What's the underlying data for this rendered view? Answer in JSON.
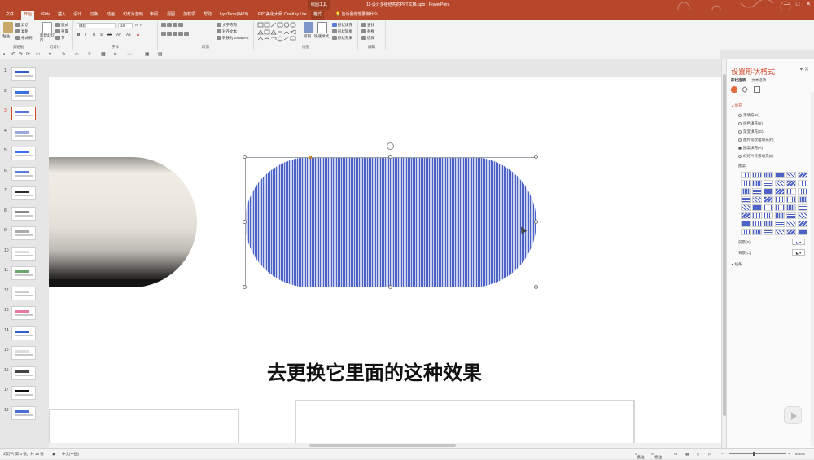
{
  "window": {
    "title": "11-设计多级结构的PPT文档.pptx - PowerPoint",
    "contextual_tab_group": "绘图工具",
    "buttons": [
      "—",
      "□",
      "✕"
    ]
  },
  "ribbon_tabs": [
    {
      "label": "文件"
    },
    {
      "label": "开始",
      "active": true
    },
    {
      "label": "iSlide"
    },
    {
      "label": "插入"
    },
    {
      "label": "设计"
    },
    {
      "label": "切换"
    },
    {
      "label": "动画"
    },
    {
      "label": "幻灯片放映"
    },
    {
      "label": "审阅"
    },
    {
      "label": "视图"
    },
    {
      "label": "加载项"
    },
    {
      "label": "帮助"
    },
    {
      "label": "lvyhTools(0429)"
    },
    {
      "label": "PPT美化大师"
    },
    {
      "label": "OneKey Lite"
    },
    {
      "label": "格式",
      "contextual": true
    }
  ],
  "tell_me": "告诉我你想要做什么",
  "ribbon": {
    "clipboard": {
      "paste": "粘贴",
      "cut": "剪切",
      "copy": "复制",
      "format_painter": "格式刷",
      "name": "剪贴板"
    },
    "slides": {
      "new_slide": "新建幻灯片",
      "layout": "版式",
      "reset": "重置",
      "section": "节",
      "name": "幻灯片"
    },
    "font": {
      "font_name": "微软",
      "font_size": "18",
      "name": "字体",
      "buttons": [
        "B",
        "I",
        "U",
        "S",
        "ab",
        "AV",
        "Aa",
        "A",
        "A"
      ]
    },
    "paragraph": {
      "text_direction": "文字方向",
      "align_text": "对齐文本",
      "smartart": "转换为 SmartArt",
      "name": "段落"
    },
    "drawing": {
      "arrange": "排列",
      "quick_styles": "快速样式",
      "shape_fill": "形状填充",
      "shape_outline": "形状轮廓",
      "shape_effects": "形状效果",
      "name": "绘图"
    },
    "editing": {
      "find": "查找",
      "replace": "替换",
      "select": "选择",
      "name": "编辑"
    }
  },
  "thumbnails": {
    "count": 18,
    "selected": 3,
    "numbers": [
      "1",
      "2",
      "3",
      "4",
      "5",
      "6",
      "7",
      "8",
      "9",
      "10",
      "11",
      "12",
      "13",
      "14",
      "15",
      "16",
      "17",
      "18"
    ]
  },
  "slide": {
    "subtitle": "去更换它里面的这种效果"
  },
  "pane": {
    "title": "设置形状格式",
    "tabs": [
      "形状选项",
      "文本选项"
    ],
    "section_fill": "填充",
    "fill_options": [
      {
        "label": "无填充(N)",
        "selected": false
      },
      {
        "label": "纯色填充(S)",
        "selected": false
      },
      {
        "label": "渐变填充(G)",
        "selected": false
      },
      {
        "label": "图片或纹理填充(P)",
        "selected": false
      },
      {
        "label": "图案填充(A)",
        "selected": true
      },
      {
        "label": "幻灯片背景填充(B)",
        "selected": false
      }
    ],
    "pattern_label": "图案",
    "foreground_label": "前景(F)",
    "background_label": "背景(C)",
    "section_line": "线条",
    "colors": {
      "accent": "#d24726",
      "pattern_fg": "#4d62c7",
      "pattern_bg": "#c9d0ee"
    }
  },
  "status": {
    "slide_info": "幻灯片 第 3 张，共 18 张",
    "language": "中文(中国)",
    "notes": "备注",
    "comments": "批注",
    "zoom": "400%"
  }
}
